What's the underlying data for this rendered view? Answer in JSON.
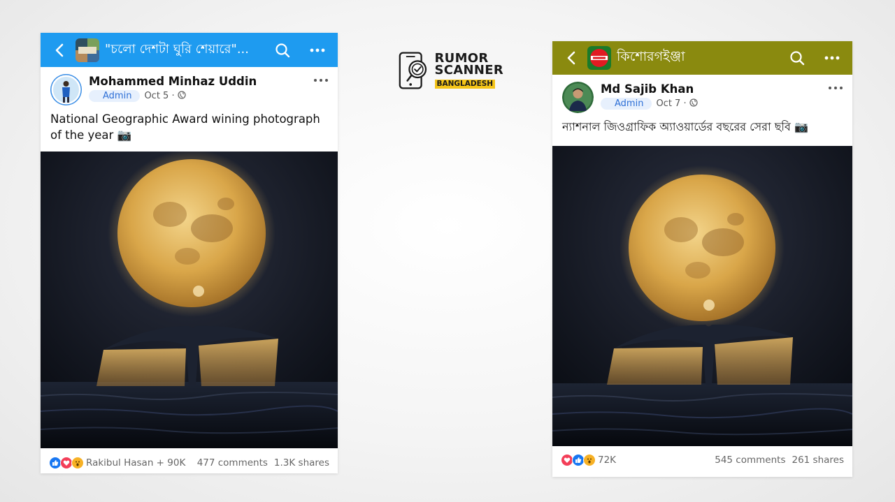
{
  "colors": {
    "left_bar": "#1e9bf0",
    "right_bar": "#8a8a0f",
    "accent_blue": "#2d6fd6"
  },
  "left_post": {
    "group_name": "\"চলো দেশটা ঘুরি শেয়ারে\"...",
    "author": "Mohammed Minhaz Uddin",
    "badge": "Admin",
    "date": "Oct 5 ·",
    "text": "National Geographic Award wining photograph of the year 📷",
    "reactions_label": "Rakibul Hasan + 90K",
    "comments": "477 comments",
    "shares": "1.3K shares",
    "icons": [
      "back-arrow-icon",
      "search-icon",
      "more-icon",
      "globe-icon",
      "like-icon",
      "love-icon",
      "wow-icon"
    ]
  },
  "logo": {
    "line1": "RUMOR",
    "line2": "SCANNER",
    "line3": "BANGLADESH"
  },
  "right_post": {
    "group_name": "কিশোরগইঞ্জা",
    "author": "Md Sajib Khan",
    "badge": "Admin",
    "date": "Oct 7 ·",
    "text": "ন্যাশনাল জিওগ্রাফিক অ্যাওয়ার্ডের বছরের সেরা ছবি 📷",
    "reactions_label": "72K",
    "comments": "545 comments",
    "shares": "261 shares",
    "icons": [
      "back-arrow-icon",
      "search-icon",
      "more-icon",
      "globe-icon",
      "love-icon",
      "like-icon",
      "wow-icon"
    ]
  }
}
